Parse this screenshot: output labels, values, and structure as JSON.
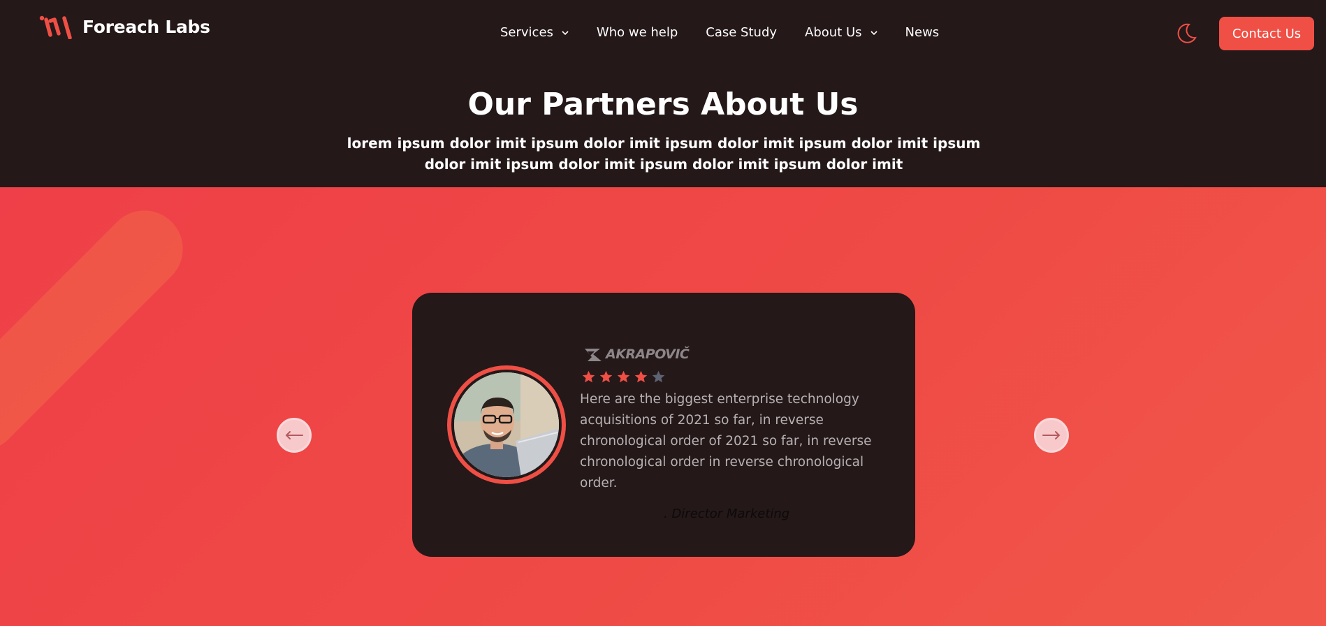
{
  "brand": {
    "name": "Foreach Labs"
  },
  "nav": {
    "items": [
      {
        "label": "Services",
        "has_dropdown": true
      },
      {
        "label": "Who we help",
        "has_dropdown": false
      },
      {
        "label": "Case Study",
        "has_dropdown": false
      },
      {
        "label": "About Us",
        "has_dropdown": true
      },
      {
        "label": "News",
        "has_dropdown": false
      }
    ],
    "dropdown_glyph": "⌄",
    "theme_toggle_icon": "moon-icon",
    "contact_label": "Contact Us"
  },
  "hero": {
    "title": "Our Partners About Us",
    "subtitle": "lorem ipsum dolor imit ipsum dolor imit ipsum dolor imit ipsum dolor imit ipsum dolor imit ipsum dolor imit ipsum dolor imit ipsum dolor imit"
  },
  "testimonial": {
    "company": "AKRAPOVIČ",
    "rating": 4,
    "rating_max": 5,
    "quote": "Here are the biggest enterprise technology acquisitions of 2021 so far, in reverse chronological order of 2021 so far, in reverse chronological order in reverse chronological order.",
    "author": ". Director Marketing"
  },
  "carousel": {
    "prev_icon": "arrow-left-icon",
    "next_icon": "arrow-right-icon"
  },
  "colors": {
    "accent": "#ef4f45",
    "dark_bg": "#241819",
    "section_bg": "#ef4547",
    "star_filled": "#ef4f45",
    "star_empty": "#5d6373"
  }
}
